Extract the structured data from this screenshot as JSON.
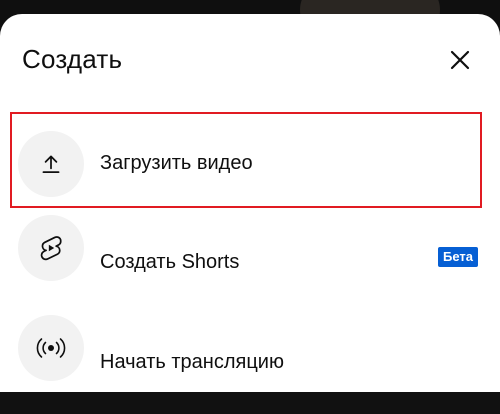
{
  "sheet": {
    "title": "Создать",
    "close_icon": "close-icon"
  },
  "items": [
    {
      "label": "Загрузить видео",
      "icon": "upload-icon",
      "highlighted": true
    },
    {
      "label": "Создать Shorts",
      "icon": "shorts-icon",
      "badge": "Бета"
    },
    {
      "label": "Начать трансляцию",
      "icon": "live-broadcast-icon"
    }
  ],
  "colors": {
    "highlight_border": "#e11b22",
    "badge_background": "#065fd4",
    "icon_circle": "#f2f2f2"
  }
}
